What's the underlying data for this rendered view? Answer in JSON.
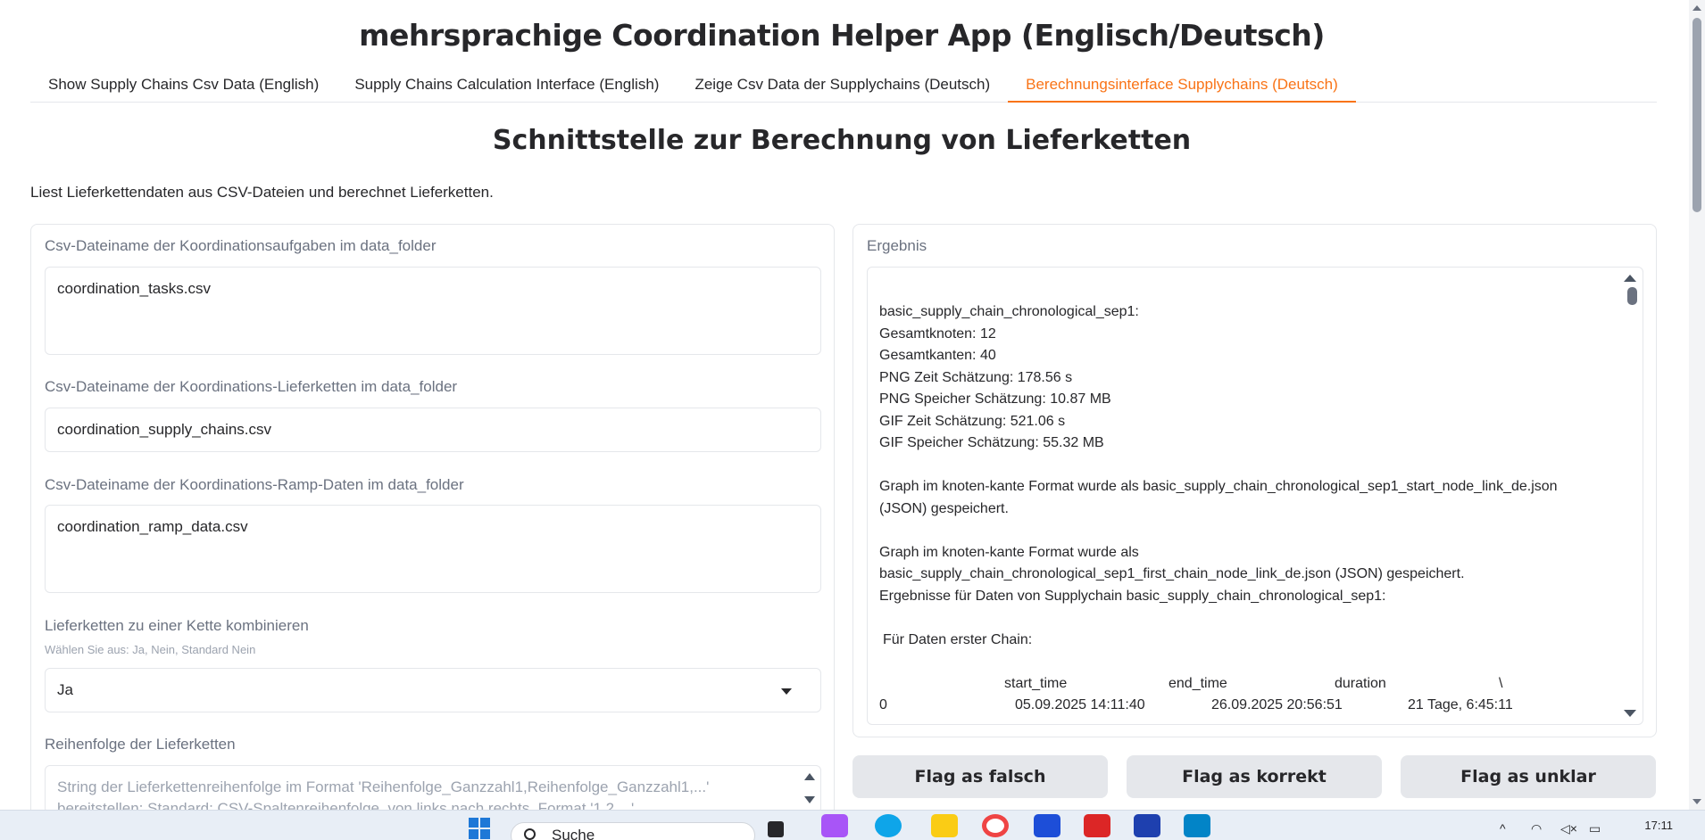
{
  "app": {
    "title": "mehrsprachige Coordination Helper App (Englisch/Deutsch)"
  },
  "tabs": [
    {
      "label": "Show Supply Chains Csv Data (English)"
    },
    {
      "label": "Supply Chains Calculation Interface (English)"
    },
    {
      "label": "Zeige Csv Data der Supplychains (Deutsch)"
    },
    {
      "label": "Berechnungsinterface Supplychains (Deutsch)"
    }
  ],
  "main": {
    "title": "Schnittstelle zur Berechnung von Lieferketten",
    "description": "Liest Lieferkettendaten aus CSV-Dateien und berechnet Lieferketten."
  },
  "form": {
    "tasks_label": "Csv-Dateiname der Koordinationsaufgaben im data_folder",
    "tasks_value": "coordination_tasks.csv",
    "chains_label": "Csv-Dateiname der Koordinations-Lieferketten im data_folder",
    "chains_value": "coordination_supply_chains.csv",
    "ramp_label": "Csv-Dateiname der Koordinations-Ramp-Daten im data_folder",
    "ramp_value": "coordination_ramp_data.csv",
    "combine_label": "Lieferketten zu einer Kette kombinieren",
    "combine_hint": "Wählen Sie aus: Ja, Nein, Standard Nein",
    "combine_value": "Ja",
    "order_label": "Reihenfolge der Lieferketten",
    "order_placeholder": "String der Lieferkettenreihenfolge im Format 'Reihenfolge_Ganzzahl1,Reihenfolge_Ganzzahl1,...' bereitstellen; Standard: CSV-Spaltenreihenfolge, von links nach rechts, Format '1,2,...'"
  },
  "result": {
    "label": "Ergebnis",
    "lines": [
      "basic_supply_chain_chronological_sep1:",
      "Gesamtknoten: 12",
      "Gesamtkanten: 40",
      "PNG Zeit Schätzung: 178.56 s",
      "PNG Speicher Schätzung: 10.87 MB",
      "GIF Zeit Schätzung: 521.06 s",
      "GIF Speicher Schätzung: 55.32 MB",
      "",
      "Graph im knoten-kante Format wurde als basic_supply_chain_chronological_sep1_start_node_link_de.json",
      "(JSON) gespeichert.",
      "",
      "Graph im knoten-kante Format wurde als",
      "basic_supply_chain_chronological_sep1_first_chain_node_link_de.json (JSON) gespeichert.",
      "Ergebnisse für Daten von Supplychain basic_supply_chain_chronological_sep1:",
      "",
      " Für Daten erster Chain:",
      ""
    ],
    "table_header": [
      "start_time",
      "end_time",
      "duration",
      "\\"
    ],
    "table_rows": [
      [
        "0",
        "05.09.2025 14:11:40",
        "26.09.2025 20:56:51",
        "21 Tage, 6:45:11"
      ]
    ]
  },
  "buttons": {
    "flag_false": "Flag as falsch",
    "flag_correct": "Flag as korrekt",
    "flag_unclear": "Flag as unklar"
  },
  "taskbar": {
    "search_label": "Suche",
    "time": "17:11"
  },
  "colors": {
    "accent": "#f97316",
    "button_bg": "#e5e7eb",
    "border": "#e5e7eb"
  }
}
